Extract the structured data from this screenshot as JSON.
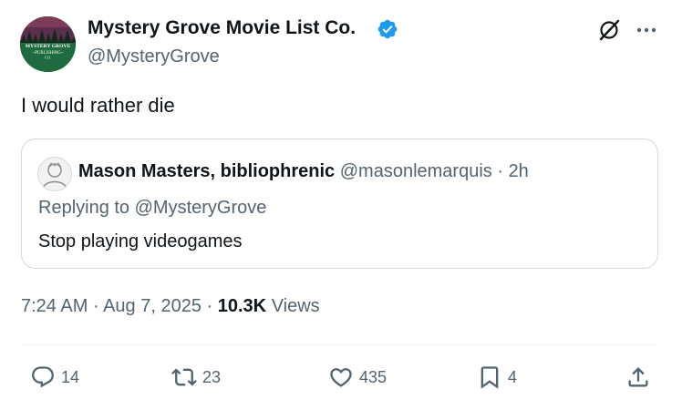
{
  "tweet": {
    "author": {
      "name": "Mystery Grove Movie List Co.",
      "handle": "@MysteryGrove",
      "avatar_text_line1": "MYSTERY GROVE",
      "avatar_text_line2": "~PUBLISHING~",
      "avatar_text_line3": "CO.",
      "verified_color": "#1d9bf0"
    },
    "text": "I would rather die",
    "quoted": {
      "name": "Mason Masters, bibliophrenic",
      "handle": "@masonlemarquis",
      "separator": "·",
      "time": "2h",
      "replying_to": "Replying to @MysteryGrove",
      "text": "Stop playing videogames"
    },
    "meta": {
      "time": "7:24 AM",
      "sep1": "·",
      "date": "Aug 7, 2025",
      "sep2": "·",
      "views_count": "10.3K",
      "views_label": "Views"
    },
    "actions": {
      "replies": "14",
      "reposts": "23",
      "likes": "435",
      "bookmarks": "4"
    }
  },
  "colors": {
    "text_primary": "#0f1419",
    "text_secondary": "#536471",
    "border": "#cfd9de",
    "accent": "#1d9bf0"
  }
}
